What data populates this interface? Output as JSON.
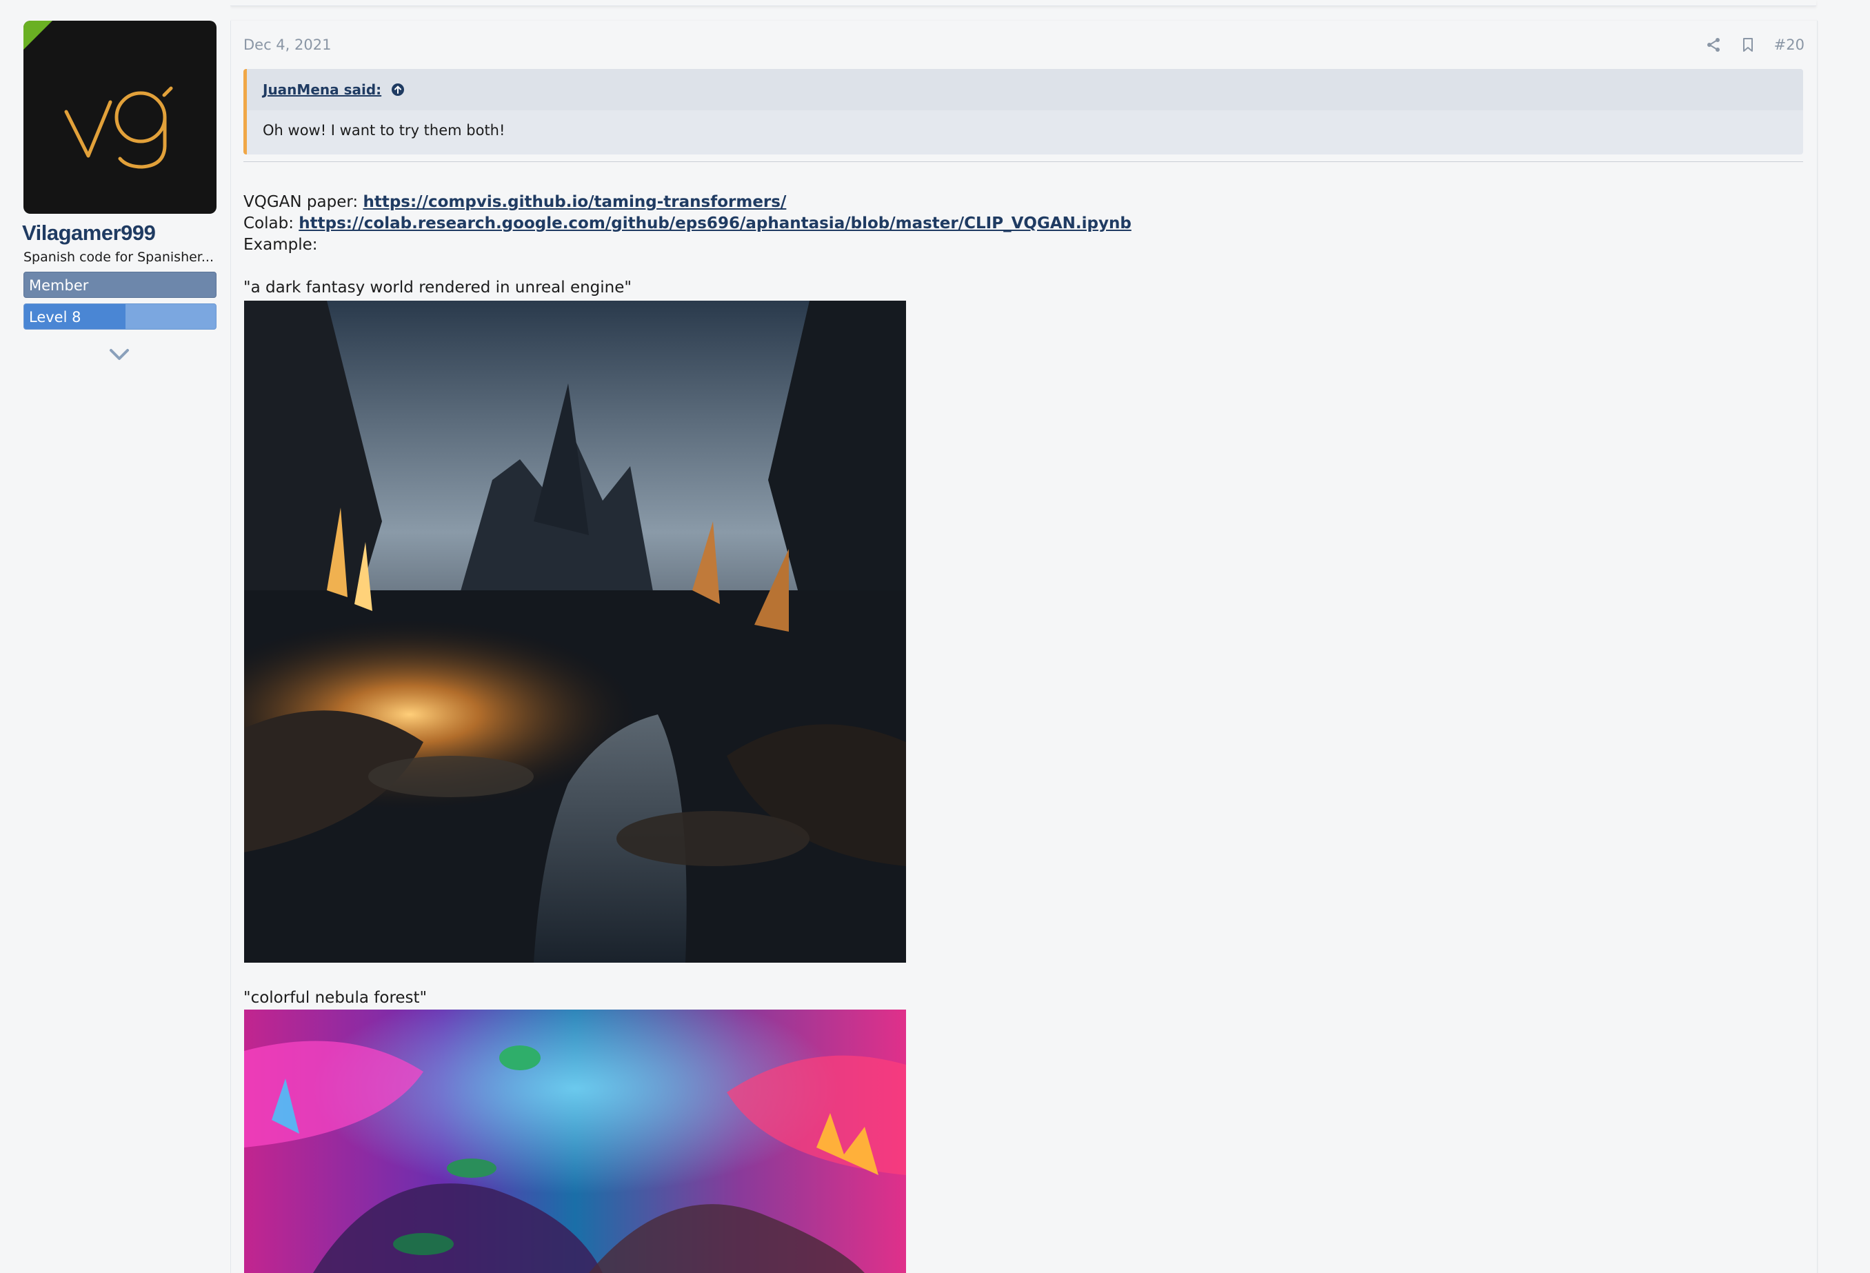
{
  "user": {
    "name": "Vilagamer999",
    "title": "Spanish code for Spanisher...",
    "avatar_text": "Vg",
    "banners": {
      "member": "Member",
      "level": "Level 8",
      "level_progress": 0.53
    },
    "expand_icon": "chevron-down-icon"
  },
  "post": {
    "date": "Dec 4, 2021",
    "number": "#20",
    "icons": [
      "share-icon",
      "bookmark-icon"
    ],
    "quote": {
      "author": "JuanMena said:",
      "goto_icon": "arrow-up-circle-icon",
      "text": "Oh wow! I want to try them both!"
    },
    "lines": {
      "paper_label": "VQGAN paper: ",
      "paper_link": "https://compvis.github.io/taming-transformers/",
      "colab_label": "Colab: ",
      "colab_link": "https://colab.research.google.com/github/eps696/aphantasia/blob/master/CLIP_VQGAN.ipynb",
      "example_label": "Example:"
    },
    "examples": [
      {
        "caption": "\"a dark fantasy world rendered in unreal engine\""
      },
      {
        "caption": "\"colorful nebula forest\""
      }
    ]
  },
  "colors": {
    "accent": "#1f3b62",
    "quote_border": "#f0a747",
    "avatar_corner": "#6ab023",
    "member_banner": "#6d87ab",
    "level_banner": "#4a86d4"
  }
}
